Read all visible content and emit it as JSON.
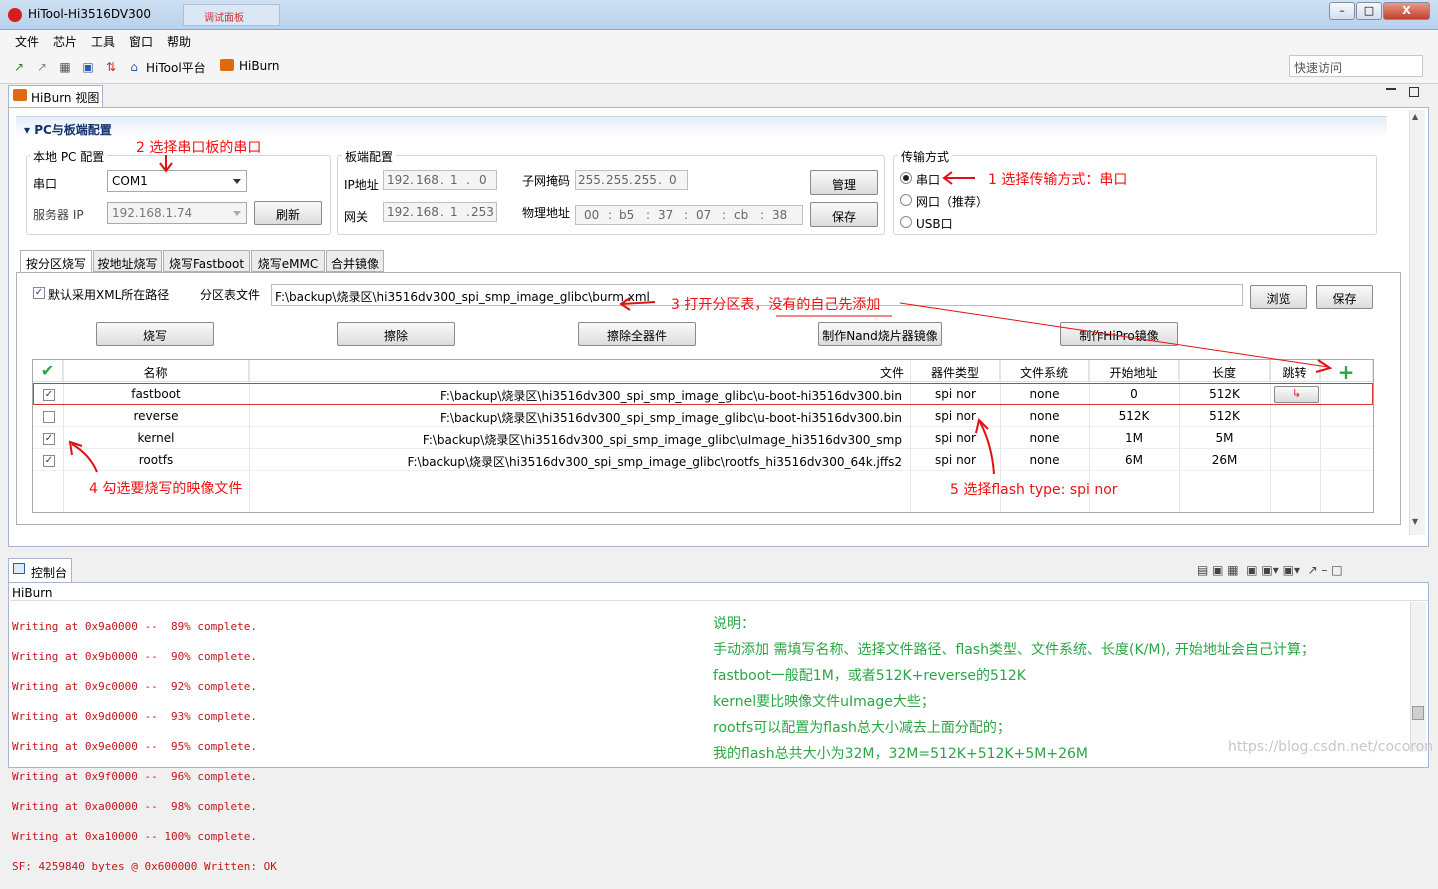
{
  "window": {
    "title": "HiTool-Hi3516DV300",
    "ghost_tab": "调试面板",
    "minimize": "–",
    "maximize": "□",
    "close": "X"
  },
  "menu": [
    "文件",
    "芯片",
    "工具",
    "窗口",
    "帮助"
  ],
  "toolbar": {
    "hitool_label": "HiTool平台",
    "hiburn_label": "HiBurn",
    "quick_access_placeholder": "快速访问"
  },
  "view": {
    "tab_label": "HiBurn 视图",
    "section_title": "PC与板端配置"
  },
  "local_pc": {
    "group": "本地 PC 配置",
    "serial_label": "串口",
    "serial_value": "COM1",
    "server_ip_label": "服务器 IP",
    "server_ip_value": "192.168.1.74",
    "refresh": "刷新"
  },
  "board": {
    "group": "板端配置",
    "ip_label": "IP地址",
    "ip": [
      "192",
      "168",
      "1",
      "0"
    ],
    "gateway_label": "网关",
    "gateway": [
      "192",
      "168",
      "1",
      "253"
    ],
    "mask_label": "子网掩码",
    "mask": [
      "255",
      "255",
      "255",
      "0"
    ],
    "mac_label": "物理地址",
    "mac": [
      "00",
      "b5",
      "37",
      "07",
      "cb",
      "38"
    ],
    "manage": "管理",
    "save": "保存"
  },
  "transfer": {
    "group": "传输方式",
    "options": [
      "串口",
      "网口（推荐）",
      "USB口"
    ],
    "selected": "串口"
  },
  "tabs": [
    "按分区烧写",
    "按地址烧写",
    "烧写Fastboot",
    "烧写eMMC",
    "合并镜像"
  ],
  "partition": {
    "default_xml_label": "默认采用XML所在路径",
    "table_file_label": "分区表文件",
    "table_file_value": "F:\\backup\\烧录区\\hi3516dv300_spi_smp_image_glibc\\burm.xml",
    "browse": "浏览",
    "save": "保存",
    "actions": [
      "烧写",
      "擦除",
      "擦除全器件",
      "制作Nand烧片器镜像",
      "制作HiPro镜像"
    ]
  },
  "table": {
    "headers": [
      "名称",
      "文件",
      "器件类型",
      "文件系统",
      "开始地址",
      "长度",
      "跳转"
    ],
    "rows": [
      {
        "checked": true,
        "name": "fastboot",
        "file": "F:\\backup\\烧录区\\hi3516dv300_spi_smp_image_glibc\\u-boot-hi3516dv300.bin",
        "device": "spi nor",
        "fs": "none",
        "start": "0",
        "length": "512K"
      },
      {
        "checked": false,
        "name": "reverse",
        "file": "F:\\backup\\烧录区\\hi3516dv300_spi_smp_image_glibc\\u-boot-hi3516dv300.bin",
        "device": "spi nor",
        "fs": "none",
        "start": "512K",
        "length": "512K"
      },
      {
        "checked": true,
        "name": "kernel",
        "file": "F:\\backup\\烧录区\\hi3516dv300_spi_smp_image_glibc\\uImage_hi3516dv300_smp",
        "device": "spi nor",
        "fs": "none",
        "start": "1M",
        "length": "5M"
      },
      {
        "checked": true,
        "name": "rootfs",
        "file": "F:\\backup\\烧录区\\hi3516dv300_spi_smp_image_glibc\\rootfs_hi3516dv300_64k.jffs2",
        "device": "spi nor",
        "fs": "none",
        "start": "6M",
        "length": "26M"
      }
    ]
  },
  "annotations": {
    "a1": "1 选择传输方式：串口",
    "a2": "2 选择串口板的串口",
    "a3": "3 打开分区表，没有的自己先添加",
    "a4": "4 勾选要烧写的映像文件",
    "a5": "5 选择flash type: spi nor"
  },
  "console": {
    "tab_label": "控制台",
    "title": "HiBurn",
    "lines": [
      "Writing at 0x9a0000 --  89% complete.",
      "Writing at 0x9b0000 --  90% complete.",
      "Writing at 0x9c0000 --  92% complete.",
      "Writing at 0x9d0000 --  93% complete.",
      "Writing at 0x9e0000 --  95% complete.",
      "Writing at 0x9f0000 --  96% complete.",
      "Writing at 0xa00000 --  98% complete.",
      "Writing at 0xa10000 -- 100% complete.",
      "SF: 4259840 bytes @ 0x600000 Written: OK"
    ]
  },
  "notes": [
    "说明：",
    "手动添加 需填写名称、选择文件路径、flash类型、文件系统、长度(K/M), 开始地址会自己计算；",
    "fastboot一般配1M，或者512K+reverse的512K",
    "kernel要比映像文件uImage大些；",
    "rootfs可以配置为flash总大小减去上面分配的；",
    "我的flash总共大小为32M，32M=512K+512K+5M+26M"
  ],
  "watermark": "https://blog.csdn.net/cocoron",
  "colors": {
    "annotation": "#e11111",
    "note": "#2aa646",
    "console_text": "#c4141a"
  }
}
